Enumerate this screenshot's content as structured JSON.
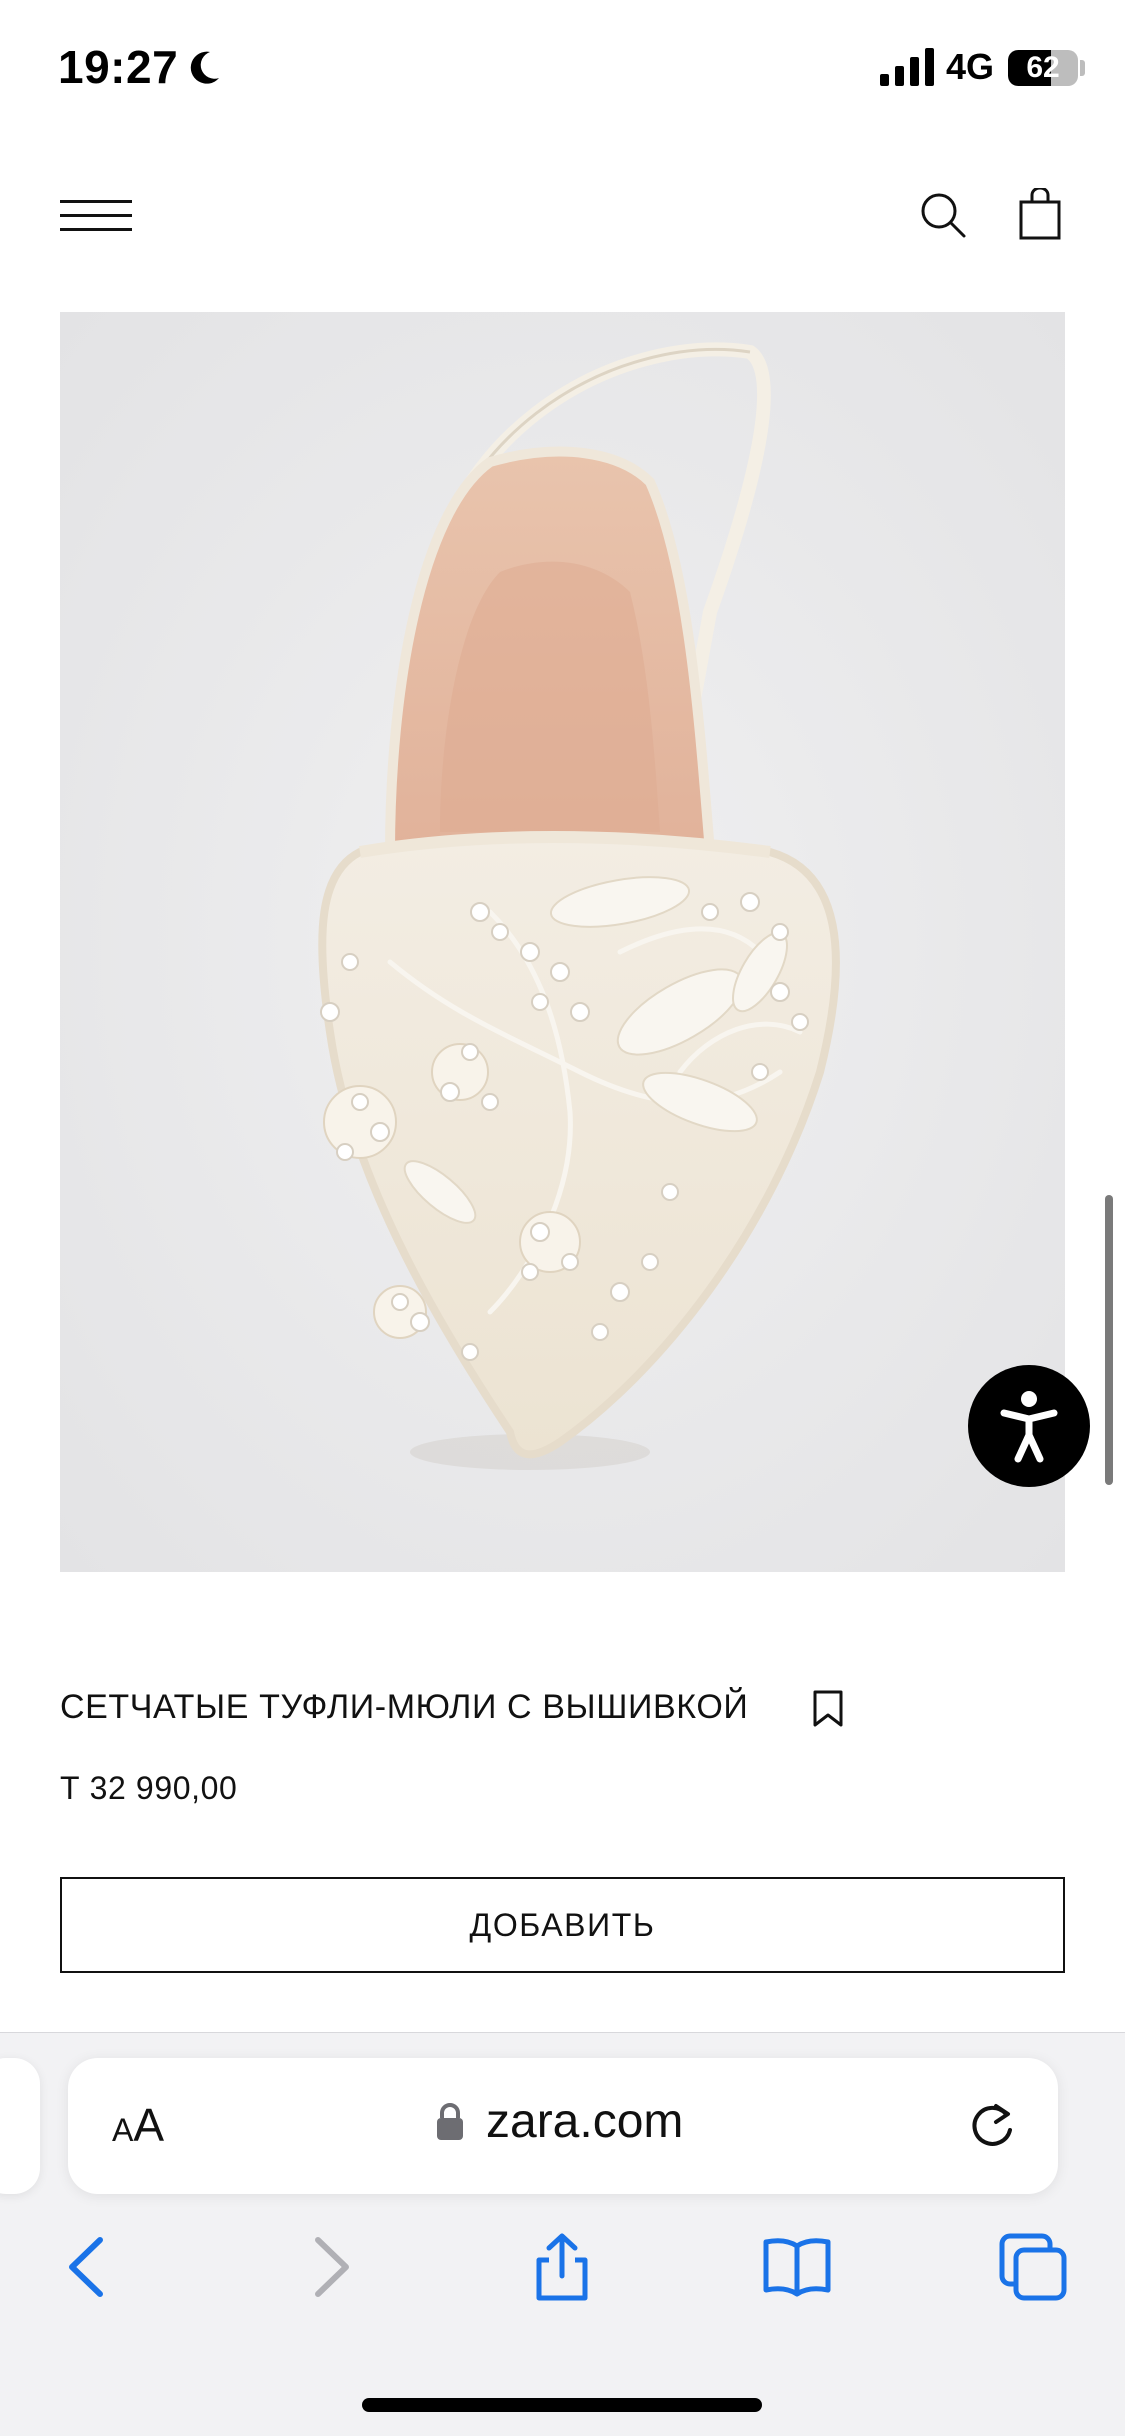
{
  "status_bar": {
    "time": "19:27",
    "network": "4G",
    "battery_percent": "62",
    "battery_level": 0.62,
    "icons": [
      "moon-icon",
      "signal-icon",
      "battery-icon"
    ]
  },
  "header": {
    "icons": [
      "menu-icon",
      "search-icon",
      "shopping-bag-icon"
    ]
  },
  "product": {
    "image_alt": "Mesh mule shoe with pearl embroidery",
    "name": "СЕТЧАТЫЕ ТУФЛИ-МЮЛИ С ВЫШИВКОЙ",
    "price": "Т 32 990,00",
    "add_button_label": "ДОБАВИТЬ"
  },
  "browser": {
    "text_size_small": "A",
    "text_size_large": "A",
    "url": "zara.com",
    "toolbar_icons": [
      "back-icon",
      "forward-icon",
      "share-icon",
      "bookmarks-icon",
      "tabs-icon"
    ],
    "accent_color": "#1a73e8",
    "disabled_color": "#b0b0b5"
  },
  "colors": {
    "image_background": "#e9e9ea",
    "accessibility_button": "#000000"
  }
}
